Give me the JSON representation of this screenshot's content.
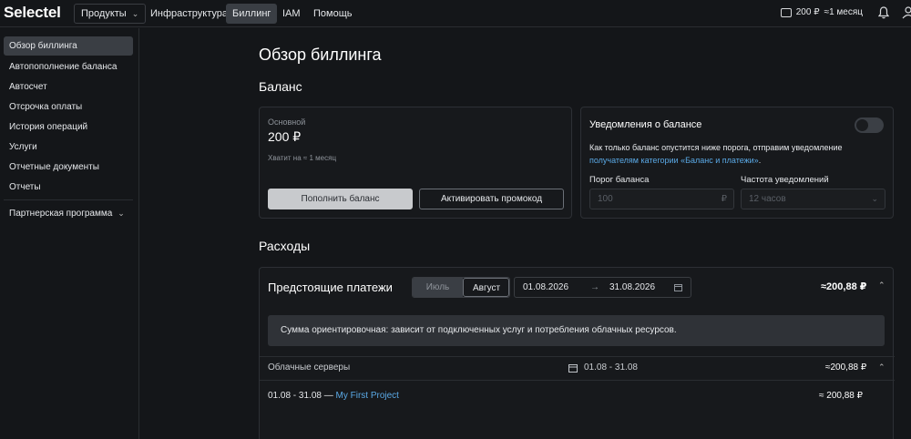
{
  "header": {
    "logo": "Selectel",
    "nav": {
      "products": "Продукты",
      "infrastructure": "Инфраструктура",
      "billing": "Биллинг",
      "iam": "IAM",
      "help": "Помощь"
    },
    "balance": "200 ₽",
    "period": "≈1 месяц"
  },
  "sidebar": {
    "items": [
      {
        "label": "Обзор биллинга"
      },
      {
        "label": "Автопополнение баланса"
      },
      {
        "label": "Автосчет"
      },
      {
        "label": "Отсрочка оплаты"
      },
      {
        "label": "История операций"
      },
      {
        "label": "Услуги"
      },
      {
        "label": "Отчетные документы"
      },
      {
        "label": "Отчеты"
      }
    ],
    "partner": "Партнерская программа"
  },
  "page": {
    "title": "Обзор биллинга",
    "balance_section": "Баланс",
    "expenses_section": "Расходы"
  },
  "balance_card": {
    "caption": "Основной",
    "amount": "200 ₽",
    "enough_for": "Хватит на ≈ 1 месяц",
    "topup_button": "Пополнить баланс",
    "promo_button": "Активировать промокод"
  },
  "notifications": {
    "title": "Уведомления о балансе",
    "text": "Как только баланс опустится ниже порога, отправим уведомление",
    "link": "получателям категории «Баланс и платежи»",
    "link_suffix": ".",
    "threshold_label": "Порог баланса",
    "threshold_placeholder": "100",
    "threshold_unit": "₽",
    "frequency_label": "Частота уведомлений",
    "frequency_value": "12 часов"
  },
  "upcoming": {
    "title": "Предстоящие платежи",
    "months": [
      "Июль",
      "Август"
    ],
    "date_from": "01.08.2026",
    "date_arrow": "→",
    "date_to": "31.08.2026",
    "total": "≈200,88 ₽",
    "note": "Сумма ориентировочная: зависит от подключенных услуг и потребления облачных ресурсов.",
    "group": {
      "name": "Облачные серверы",
      "range": "01.08 - 31.08",
      "amount": "≈200,88 ₽"
    },
    "row": {
      "range": "01.08 - 31.08",
      "dash": " — ",
      "project": "My First Project",
      "amount": "≈ 200,88 ₽"
    }
  }
}
